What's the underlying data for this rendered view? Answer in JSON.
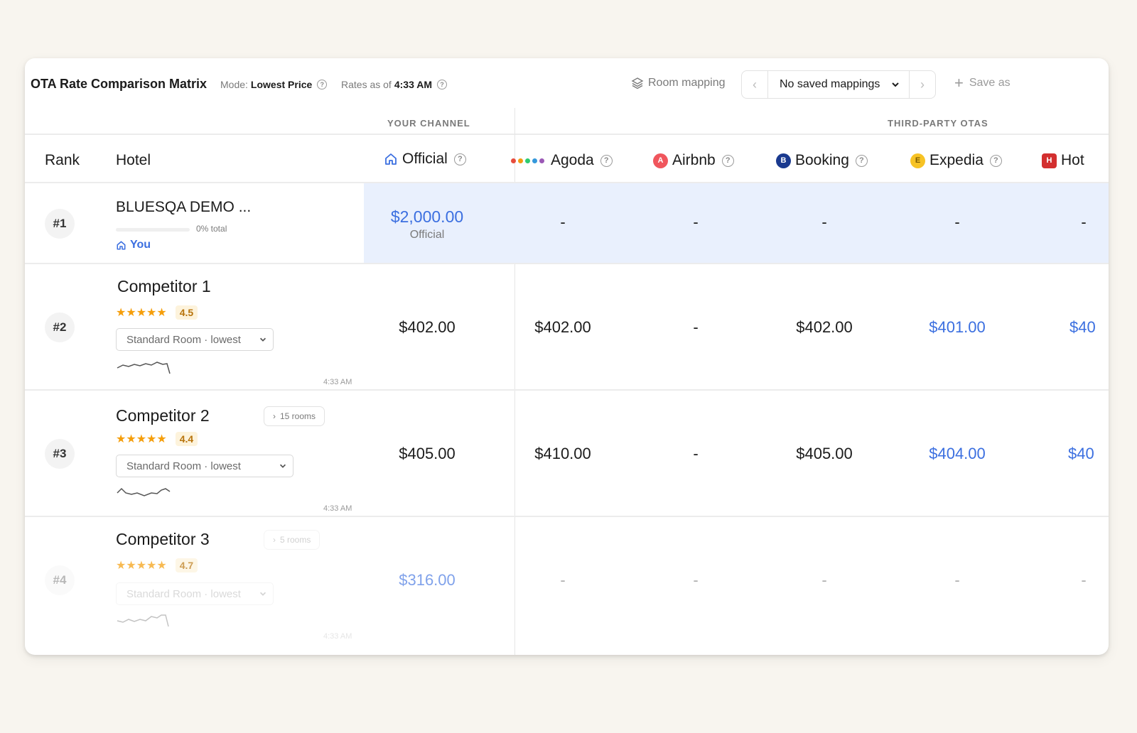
{
  "toolbar": {
    "title": "OTA Rate Comparison Matrix",
    "mode_label": "Mode:",
    "mode_value": "Lowest Price",
    "rates_label": "Rates as of",
    "rates_value": "4:33 AM",
    "room_mapping_label": "Room mapping",
    "mapping_select": "No saved mappings",
    "save_as_label": "Save as"
  },
  "groups": {
    "your_channel": "YOUR CHANNEL",
    "third_party": "THIRD-PARTY OTAS"
  },
  "columns": {
    "rank": "Rank",
    "hotel": "Hotel",
    "official": "Official",
    "agoda": "Agoda",
    "airbnb": "Airbnb",
    "booking": "Booking",
    "expedia": "Expedia",
    "hotels": "Hot"
  },
  "badges": {
    "airbnb": "A",
    "booking": "B",
    "expedia": "E",
    "hotels": "H"
  },
  "colors": {
    "accent_blue": "#3b6fe0",
    "airbnb": "#f0565d",
    "booking": "#1a3a8f",
    "expedia": "#f7c325",
    "hotels": "#d32f2f",
    "star": "#f59e0b"
  },
  "rows": [
    {
      "rank": "#1",
      "hotel": "BLUESQA DEMO ...",
      "progress_percent": 0,
      "progress_text": "0% total",
      "you_label": "You",
      "official_price": "$2,000.00",
      "official_sub": "Official",
      "agoda": "-",
      "airbnb": "-",
      "booking": "-",
      "expedia": "-",
      "hotels": "-"
    },
    {
      "rank": "#2",
      "hotel": "Competitor 1",
      "stars": "★★★★★",
      "rating": "4.5",
      "room": "Standard Room · lowest",
      "time": "4:33 AM",
      "official": "$402.00",
      "agoda": "$402.00",
      "airbnb": "-",
      "booking": "$402.00",
      "expedia": "$401.00",
      "hotels": "$40"
    },
    {
      "rank": "#3",
      "hotel": "Competitor 2",
      "rooms_btn": "15 rooms",
      "stars": "★★★★★",
      "rating": "4.4",
      "room": "Standard Room · lowest",
      "time": "4:33 AM",
      "official": "$405.00",
      "agoda": "$410.00",
      "airbnb": "-",
      "booking": "$405.00",
      "expedia": "$404.00",
      "hotels": "$40"
    },
    {
      "rank": "#4",
      "hotel": "Competitor 3",
      "rooms_btn": "5 rooms",
      "stars": "★★★★★",
      "rating": "4.7",
      "room": "Standard Room · lowest",
      "time": "4:33 AM",
      "official": "$316.00",
      "agoda": "-",
      "airbnb": "-",
      "booking": "-",
      "expedia": "-",
      "hotels": "-"
    }
  ]
}
